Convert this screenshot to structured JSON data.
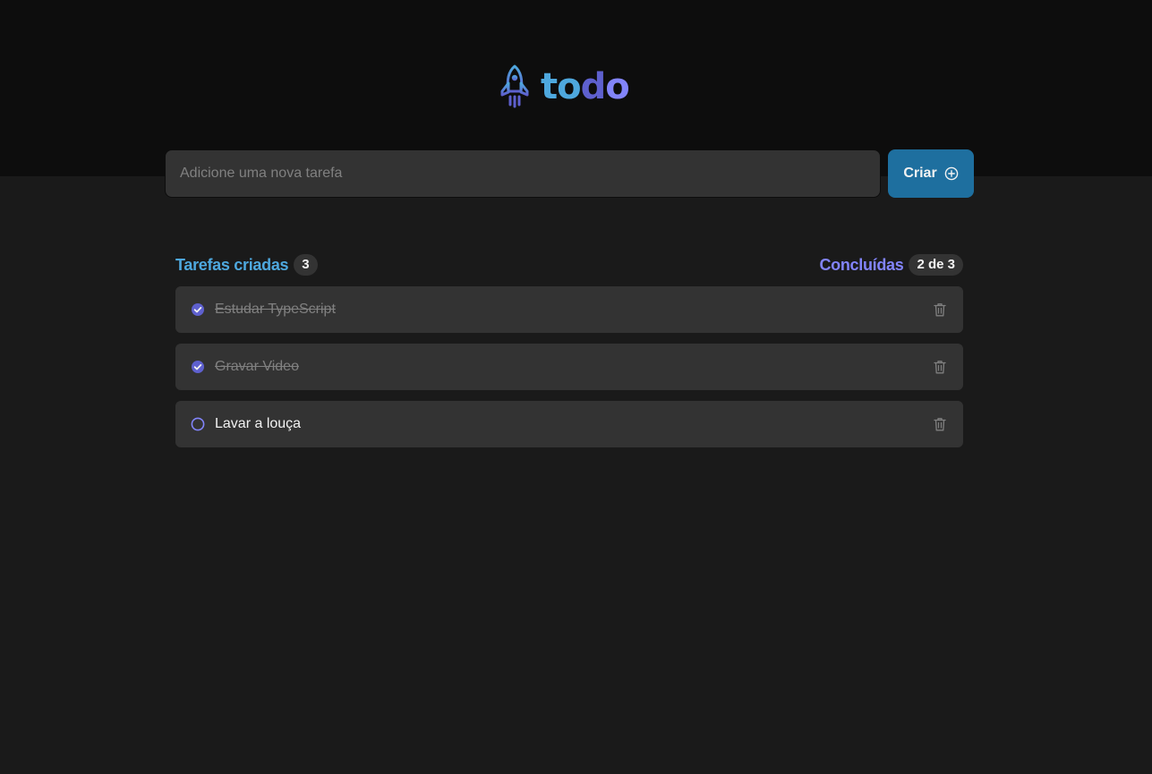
{
  "header": {
    "logo_icon": "rocket-icon",
    "logo_text_parts": [
      "to",
      "d",
      "o"
    ],
    "colors": {
      "blue": "#4ea8de",
      "purple_dark": "#5e60ce",
      "purple": "#8284fa"
    }
  },
  "new_task": {
    "placeholder": "Adicione uma nova tarefa",
    "value": "",
    "create_label": "Criar",
    "create_icon": "plus-circle-icon",
    "button_color": "#1e6f9f"
  },
  "counters": {
    "created_label": "Tarefas criadas",
    "created_count": "3",
    "done_label": "Concluídas",
    "done_count": "2 de 3"
  },
  "tasks": [
    {
      "text": "Estudar TypeScript",
      "completed": true
    },
    {
      "text": "Gravar Video",
      "completed": true
    },
    {
      "text": "Lavar a louça",
      "completed": false
    }
  ]
}
